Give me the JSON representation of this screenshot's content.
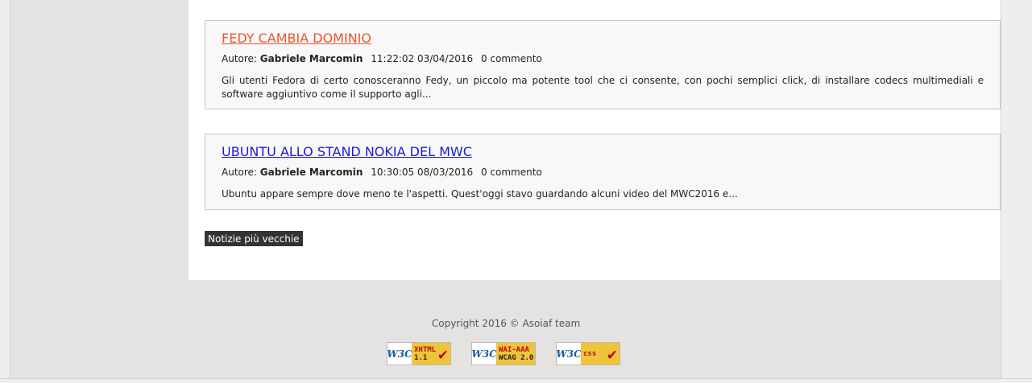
{
  "posts": [
    {
      "title": "FEDY CAMBIA DOMINIO",
      "author_label": "Autore:",
      "author": "Gabriele Marcomin",
      "datetime": "11:22:02 03/04/2016",
      "comments": "0 commento",
      "excerpt": "Gli utenti Fedora di certo conosceranno Fedy, un piccolo ma potente tool che ci consente, con pochi semplici click, di installare codecs multimediali e software aggiuntivo come il supporto agli..."
    },
    {
      "title": "UBUNTU ALLO STAND NOKIA DEL MWC",
      "author_label": "Autore:",
      "author": "Gabriele Marcomin",
      "datetime": "10:30:05 08/03/2016",
      "comments": "0 commento",
      "excerpt": "Ubuntu appare sempre dove meno te l'aspetti. Quest'oggi stavo guardando alcuni video del MWC2016 e..."
    }
  ],
  "pagination": {
    "older_label": "Notizie più vecchie"
  },
  "footer": {
    "copyright": "Copyright 2016 © Asoiaf team",
    "badges": [
      {
        "icon": "w3c-xhtml-badge-icon",
        "logo": "W3C",
        "line1": "XHTML",
        "line2": "1.1"
      },
      {
        "icon": "w3c-wcag-badge-icon",
        "logo": "W3C",
        "line1": "WAI-AAA",
        "line2": "WCAG 2.0"
      },
      {
        "icon": "w3c-css-badge-icon",
        "logo": "W3C",
        "line1": "css",
        "line2": ""
      }
    ]
  },
  "colors": {
    "post1_title": "#e8562c",
    "post2_title": "#1a1ad8",
    "button_bg": "#333333",
    "page_bg": "#e5e3e1"
  }
}
